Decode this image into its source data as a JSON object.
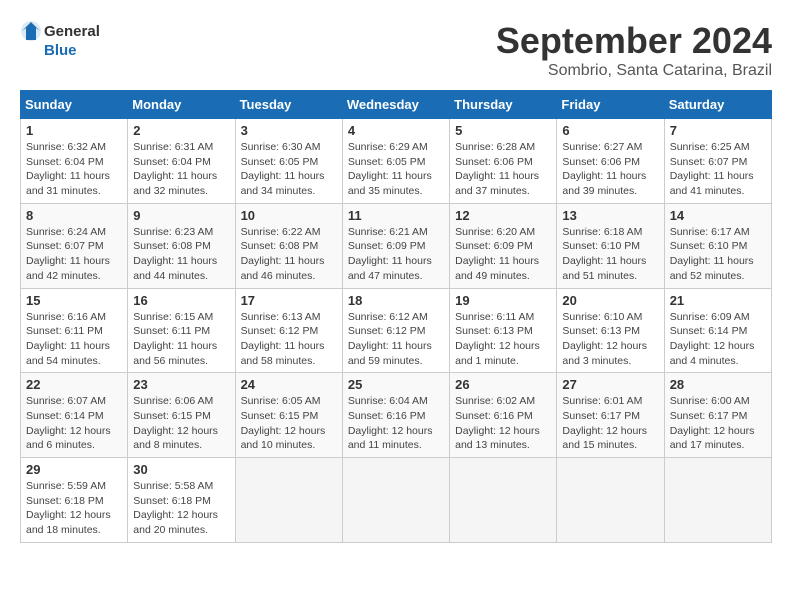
{
  "header": {
    "logo_general": "General",
    "logo_blue": "Blue",
    "month_title": "September 2024",
    "subtitle": "Sombrio, Santa Catarina, Brazil"
  },
  "weekdays": [
    "Sunday",
    "Monday",
    "Tuesday",
    "Wednesday",
    "Thursday",
    "Friday",
    "Saturday"
  ],
  "days": [
    {
      "num": "",
      "detail": ""
    },
    {
      "num": "",
      "detail": ""
    },
    {
      "num": "",
      "detail": ""
    },
    {
      "num": "",
      "detail": ""
    },
    {
      "num": "",
      "detail": ""
    },
    {
      "num": "",
      "detail": ""
    },
    {
      "num": "",
      "detail": ""
    },
    {
      "num": "1",
      "detail": "Sunrise: 6:32 AM\nSunset: 6:04 PM\nDaylight: 11 hours\nand 31 minutes."
    },
    {
      "num": "2",
      "detail": "Sunrise: 6:31 AM\nSunset: 6:04 PM\nDaylight: 11 hours\nand 32 minutes."
    },
    {
      "num": "3",
      "detail": "Sunrise: 6:30 AM\nSunset: 6:05 PM\nDaylight: 11 hours\nand 34 minutes."
    },
    {
      "num": "4",
      "detail": "Sunrise: 6:29 AM\nSunset: 6:05 PM\nDaylight: 11 hours\nand 35 minutes."
    },
    {
      "num": "5",
      "detail": "Sunrise: 6:28 AM\nSunset: 6:06 PM\nDaylight: 11 hours\nand 37 minutes."
    },
    {
      "num": "6",
      "detail": "Sunrise: 6:27 AM\nSunset: 6:06 PM\nDaylight: 11 hours\nand 39 minutes."
    },
    {
      "num": "7",
      "detail": "Sunrise: 6:25 AM\nSunset: 6:07 PM\nDaylight: 11 hours\nand 41 minutes."
    },
    {
      "num": "8",
      "detail": "Sunrise: 6:24 AM\nSunset: 6:07 PM\nDaylight: 11 hours\nand 42 minutes."
    },
    {
      "num": "9",
      "detail": "Sunrise: 6:23 AM\nSunset: 6:08 PM\nDaylight: 11 hours\nand 44 minutes."
    },
    {
      "num": "10",
      "detail": "Sunrise: 6:22 AM\nSunset: 6:08 PM\nDaylight: 11 hours\nand 46 minutes."
    },
    {
      "num": "11",
      "detail": "Sunrise: 6:21 AM\nSunset: 6:09 PM\nDaylight: 11 hours\nand 47 minutes."
    },
    {
      "num": "12",
      "detail": "Sunrise: 6:20 AM\nSunset: 6:09 PM\nDaylight: 11 hours\nand 49 minutes."
    },
    {
      "num": "13",
      "detail": "Sunrise: 6:18 AM\nSunset: 6:10 PM\nDaylight: 11 hours\nand 51 minutes."
    },
    {
      "num": "14",
      "detail": "Sunrise: 6:17 AM\nSunset: 6:10 PM\nDaylight: 11 hours\nand 52 minutes."
    },
    {
      "num": "15",
      "detail": "Sunrise: 6:16 AM\nSunset: 6:11 PM\nDaylight: 11 hours\nand 54 minutes."
    },
    {
      "num": "16",
      "detail": "Sunrise: 6:15 AM\nSunset: 6:11 PM\nDaylight: 11 hours\nand 56 minutes."
    },
    {
      "num": "17",
      "detail": "Sunrise: 6:13 AM\nSunset: 6:12 PM\nDaylight: 11 hours\nand 58 minutes."
    },
    {
      "num": "18",
      "detail": "Sunrise: 6:12 AM\nSunset: 6:12 PM\nDaylight: 11 hours\nand 59 minutes."
    },
    {
      "num": "19",
      "detail": "Sunrise: 6:11 AM\nSunset: 6:13 PM\nDaylight: 12 hours\nand 1 minute."
    },
    {
      "num": "20",
      "detail": "Sunrise: 6:10 AM\nSunset: 6:13 PM\nDaylight: 12 hours\nand 3 minutes."
    },
    {
      "num": "21",
      "detail": "Sunrise: 6:09 AM\nSunset: 6:14 PM\nDaylight: 12 hours\nand 4 minutes."
    },
    {
      "num": "22",
      "detail": "Sunrise: 6:07 AM\nSunset: 6:14 PM\nDaylight: 12 hours\nand 6 minutes."
    },
    {
      "num": "23",
      "detail": "Sunrise: 6:06 AM\nSunset: 6:15 PM\nDaylight: 12 hours\nand 8 minutes."
    },
    {
      "num": "24",
      "detail": "Sunrise: 6:05 AM\nSunset: 6:15 PM\nDaylight: 12 hours\nand 10 minutes."
    },
    {
      "num": "25",
      "detail": "Sunrise: 6:04 AM\nSunset: 6:16 PM\nDaylight: 12 hours\nand 11 minutes."
    },
    {
      "num": "26",
      "detail": "Sunrise: 6:02 AM\nSunset: 6:16 PM\nDaylight: 12 hours\nand 13 minutes."
    },
    {
      "num": "27",
      "detail": "Sunrise: 6:01 AM\nSunset: 6:17 PM\nDaylight: 12 hours\nand 15 minutes."
    },
    {
      "num": "28",
      "detail": "Sunrise: 6:00 AM\nSunset: 6:17 PM\nDaylight: 12 hours\nand 17 minutes."
    },
    {
      "num": "29",
      "detail": "Sunrise: 5:59 AM\nSunset: 6:18 PM\nDaylight: 12 hours\nand 18 minutes."
    },
    {
      "num": "30",
      "detail": "Sunrise: 5:58 AM\nSunset: 6:18 PM\nDaylight: 12 hours\nand 20 minutes."
    },
    {
      "num": "",
      "detail": ""
    },
    {
      "num": "",
      "detail": ""
    },
    {
      "num": "",
      "detail": ""
    },
    {
      "num": "",
      "detail": ""
    },
    {
      "num": "",
      "detail": ""
    }
  ]
}
